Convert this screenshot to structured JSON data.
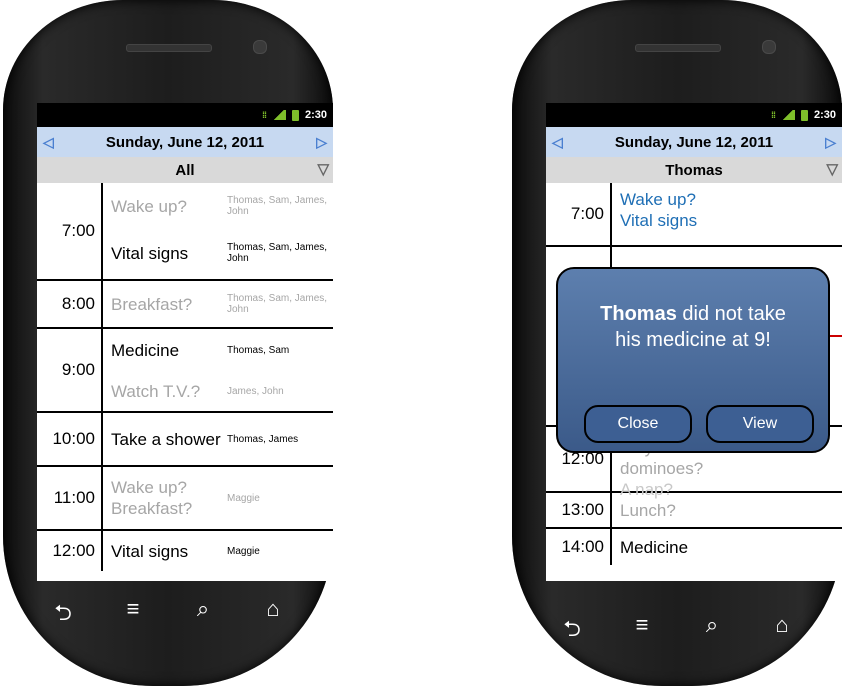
{
  "status": {
    "time": "2:30"
  },
  "left": {
    "date": "Sunday, June 12, 2011",
    "filter": "All",
    "rows": [
      {
        "time": "7:00",
        "events": [
          {
            "name": "Wake up?",
            "who": "Thomas, Sam, James, John"
          },
          {
            "name": "Vital signs",
            "who": "Thomas, Sam, James, John"
          }
        ]
      },
      {
        "time": "8:00",
        "events": [
          {
            "name": "Breakfast?",
            "who": "Thomas, Sam, James, John"
          }
        ]
      },
      {
        "time": "9:00",
        "events": [
          {
            "name": "Medicine",
            "who": "Thomas, Sam"
          },
          {
            "name": "Watch T.V.?",
            "who": "James, John"
          }
        ]
      },
      {
        "time": "10:00",
        "events": [
          {
            "name": "Take a shower",
            "who": "Thomas, James"
          }
        ]
      },
      {
        "time": "11:00",
        "events": [
          {
            "name": "Wake up? Breakfast?",
            "who": "Maggie"
          }
        ]
      },
      {
        "time": "12:00",
        "events": [
          {
            "name": "Vital signs",
            "who": "Maggie"
          }
        ]
      }
    ]
  },
  "right": {
    "date": "Sunday, June 12, 2011",
    "filter": "Thomas",
    "rows": [
      {
        "time": "7:00",
        "events": [
          "Wake up?",
          "Vital signs"
        ]
      },
      {
        "time": "12:00",
        "events": [
          "Play dominoes?",
          "A nap?"
        ]
      },
      {
        "time": "13:00",
        "events": [
          "Lunch?"
        ]
      },
      {
        "time": "14:00",
        "events": [
          "Medicine"
        ]
      }
    ],
    "popup": {
      "name": "Thomas",
      "message_rest": "did not take",
      "message_line2": "his medicine at 9!",
      "close_label": "Close",
      "view_label": "View"
    }
  },
  "colors": {
    "date_bar": "#c7d9f1",
    "filter_bar": "#d9d9d9",
    "popup": "#4a6c9c",
    "accent_blue": "#1f6fb5"
  }
}
